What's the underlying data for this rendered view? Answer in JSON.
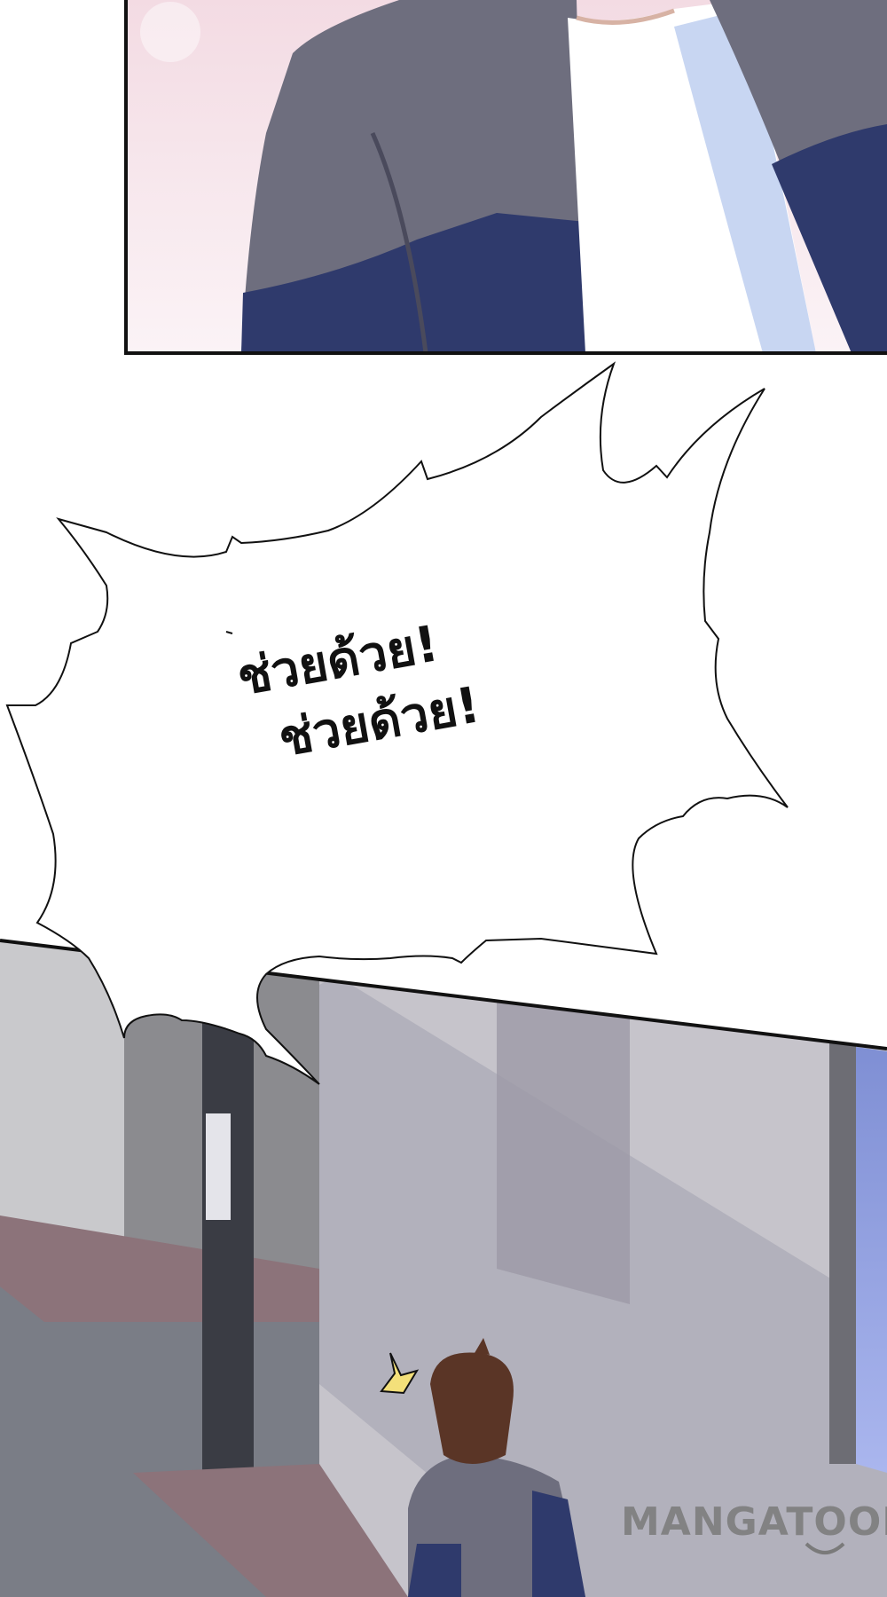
{
  "speech_bubble": {
    "lines": [
      "ช่วยด้วย!",
      "ช่วยด้วย!"
    ]
  },
  "watermark": {
    "text": "MANGATOON"
  },
  "colors": {
    "jacket_gray": "#6e6e7e",
    "jacket_navy": "#2f3a6c",
    "shirt_white": "#ffffff",
    "panel_border": "#111111",
    "wall_light": "#c9c9cc",
    "wall_dark": "#8b8b8f",
    "pole": "#3a3c44",
    "street": "#7a7d86",
    "sidewalk": "#8c737a",
    "hair": "#5a3526"
  },
  "icons": [
    "surprise-mark-icon",
    "watermark-smile-icon"
  ]
}
